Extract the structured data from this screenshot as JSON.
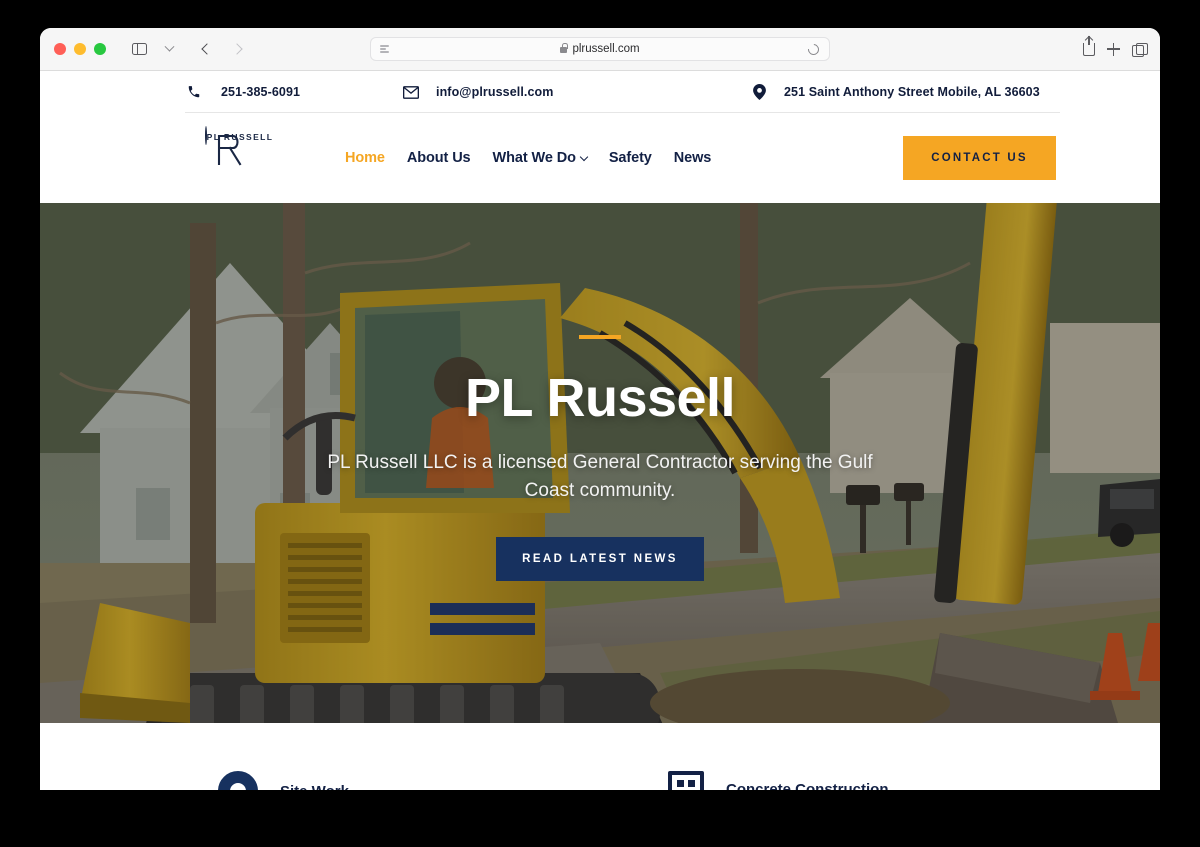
{
  "browser": {
    "url": "plrussell.com",
    "lock_icon": "lock-icon",
    "reload_icon": "reload-icon",
    "sidebar_icon": "sidebar-icon",
    "back_icon": "back-arrow-icon",
    "forward_icon": "forward-arrow-icon",
    "share_icon": "share-icon",
    "newtab_icon": "plus-icon",
    "tabs_icon": "tab-overview-icon"
  },
  "contact_bar": {
    "phone": "251-385-6091",
    "email": "info@plrussell.com",
    "address": "251 Saint Anthony Street Mobile, AL 36603",
    "phone_icon": "phone-icon",
    "mail_icon": "envelope-icon",
    "location_icon": "map-pin-icon"
  },
  "header": {
    "logo_word": "PL RUSSELL",
    "nav": [
      {
        "label": "Home",
        "active": true
      },
      {
        "label": "About Us",
        "active": false
      },
      {
        "label": "What We Do",
        "active": false,
        "caret": true
      },
      {
        "label": "Safety",
        "active": false
      },
      {
        "label": "News",
        "active": false
      }
    ],
    "cta_label": "CONTACT US"
  },
  "hero": {
    "title": "PL Russell",
    "subtitle": "PL Russell LLC is a licensed General Contractor serving the Gulf Coast community.",
    "button_label": "READ LATEST NEWS"
  },
  "services": [
    {
      "label": "Site Work",
      "icon": "ring-icon"
    },
    {
      "label": "Concrete Construction",
      "icon": "building-icon"
    }
  ],
  "colors": {
    "accent_orange": "#f5a623",
    "navy": "#132145",
    "button_navy": "#17315f"
  }
}
